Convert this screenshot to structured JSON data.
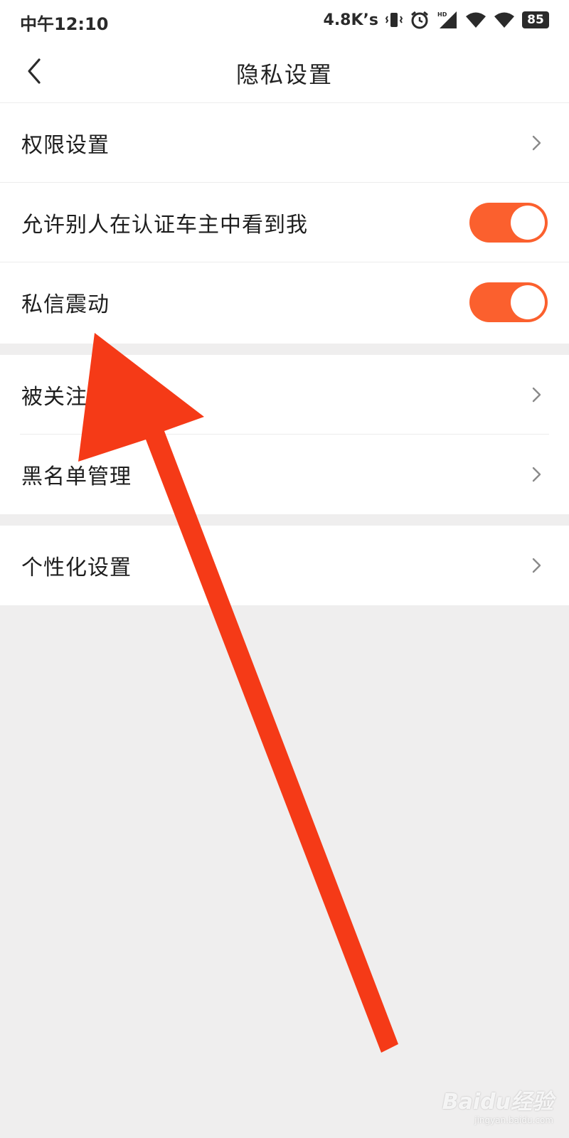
{
  "status_bar": {
    "time": "中午12:10",
    "net_speed": "4.8K’s",
    "battery": "85",
    "icons": [
      "vibrate-icon",
      "alarm-icon",
      "hd-signal-icon",
      "wifi-icon",
      "wifi-icon",
      "battery-icon"
    ]
  },
  "header": {
    "title": "隐私设置",
    "back_icon": "chevron-left-icon"
  },
  "groups": {
    "first": {
      "permission": "权限设置",
      "visible_to_owners": "允许别人在认证车主中看到我",
      "message_vibrate": "私信震动"
    },
    "second": {
      "followed_reply": "被关注复",
      "blacklist": "黑名单管理"
    },
    "third": {
      "personalization": "个性化设置"
    }
  },
  "toggles": {
    "visible_to_owners_on": true,
    "message_vibrate_on": true
  },
  "colors": {
    "accent": "#fb602e",
    "arrow": "#f53a17",
    "page_background": "#efeeee"
  },
  "watermark": {
    "brand": "Baidu经验",
    "site": "jingyan.baidu.com"
  }
}
